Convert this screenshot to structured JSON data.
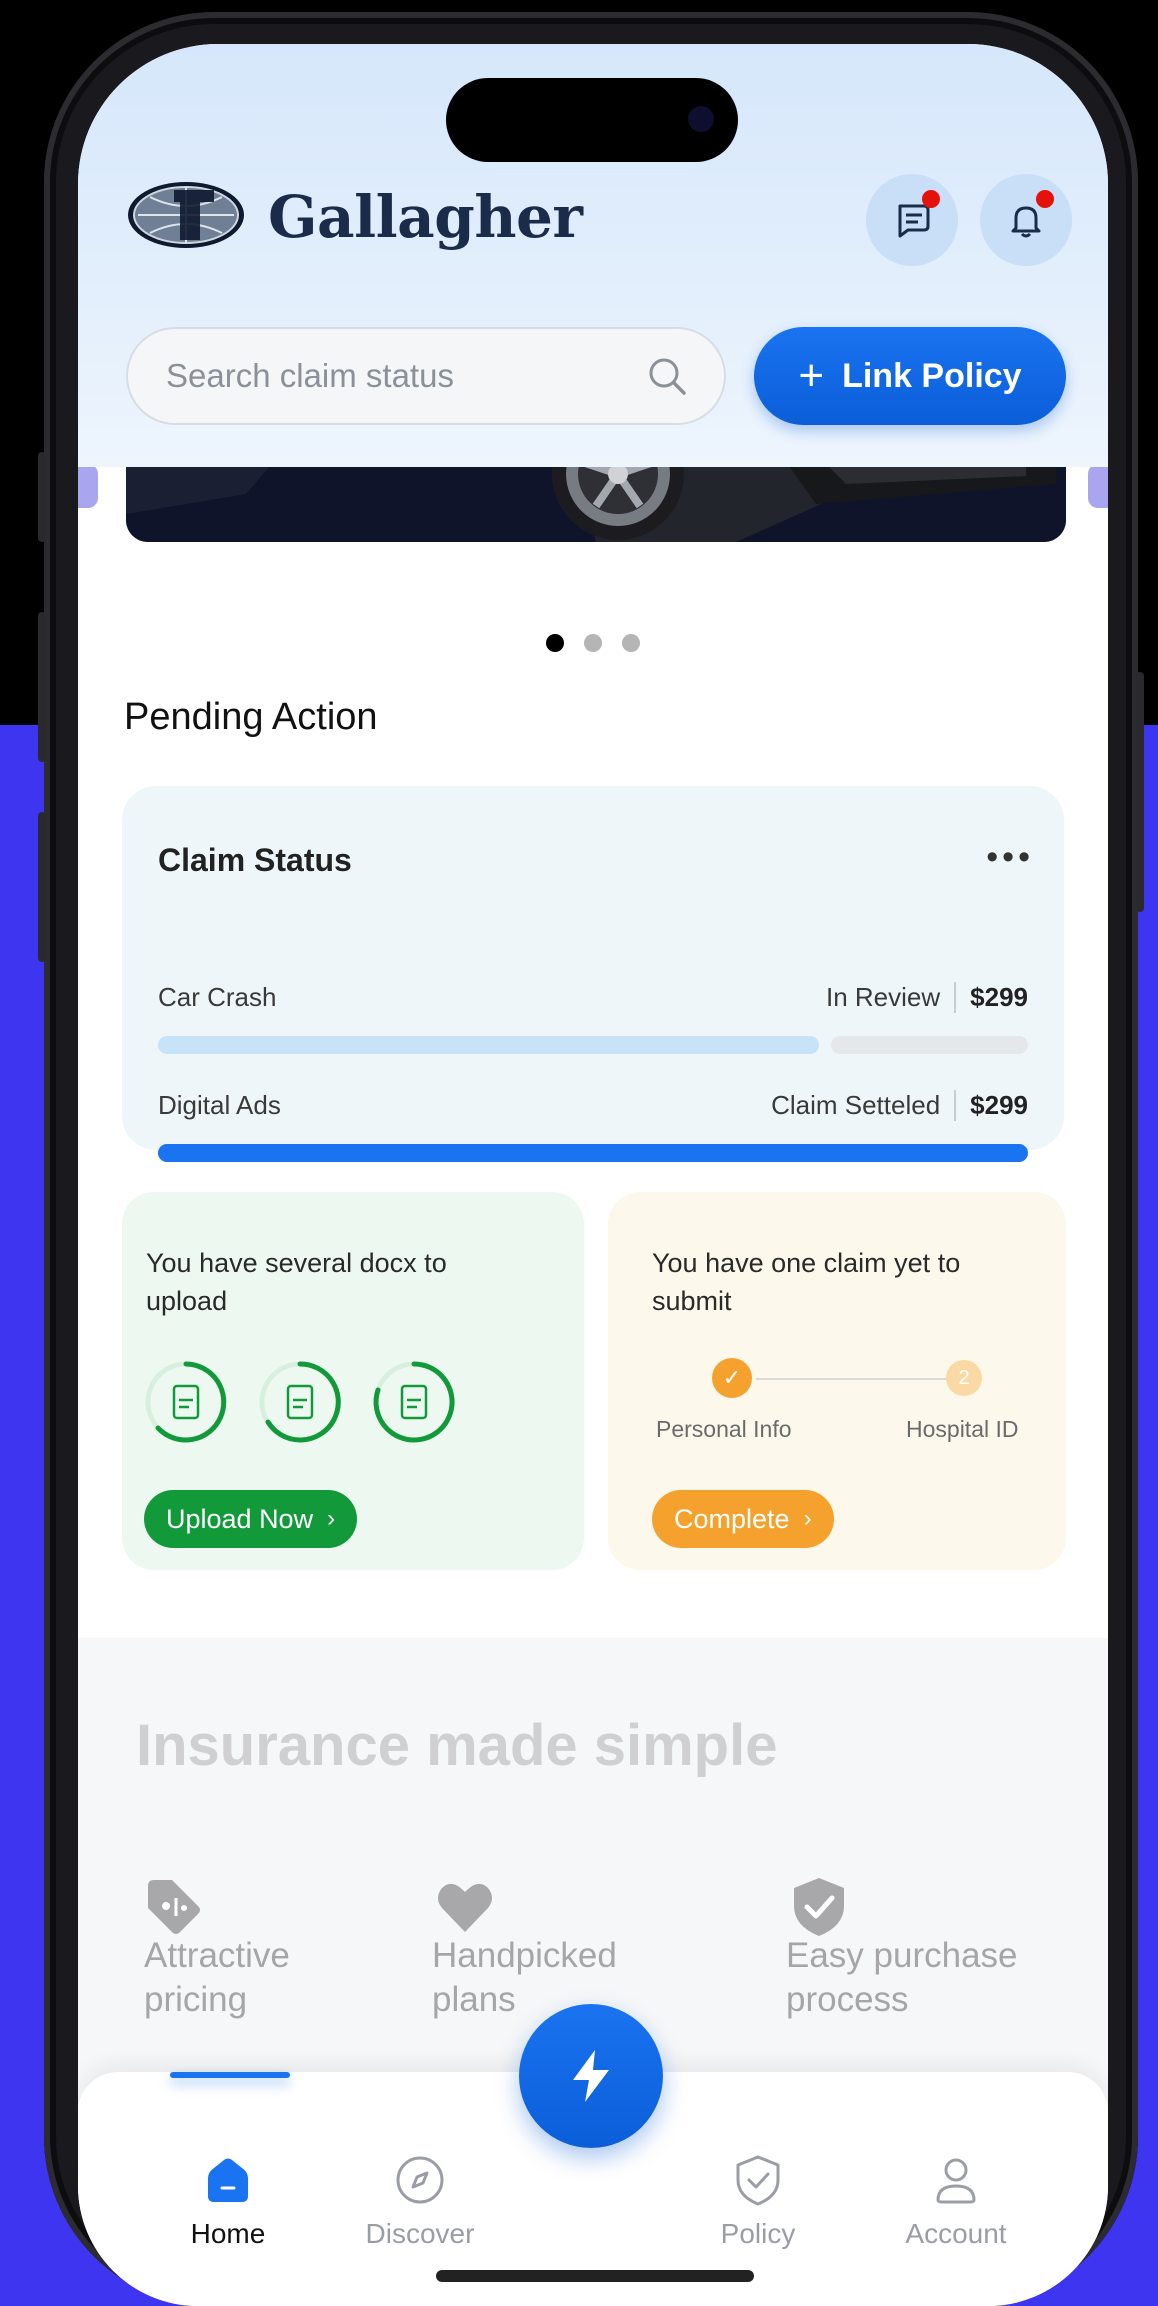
{
  "colors": {
    "primary": "#1a73f0",
    "green": "#129a3a",
    "orange": "#f5a12e",
    "backdrop": "#3d35f0"
  },
  "header": {
    "brand": "Gallagher",
    "search_placeholder": "Search claim status",
    "link_policy_label": "Link Policy",
    "icons": [
      "chat-icon",
      "bell-icon"
    ]
  },
  "banner": {
    "page_count": 3,
    "active_page": 1
  },
  "pending": {
    "title": "Pending Action",
    "claim_card": {
      "title": "Claim Status",
      "rows": [
        {
          "name": "Car Crash",
          "status": "In Review",
          "amount": "$299",
          "progress": 0.76
        },
        {
          "name": "Digital Ads",
          "status": "Claim Setteled",
          "amount": "$299",
          "progress": 1.0
        }
      ]
    },
    "upload_card": {
      "text": "You have several docx to upload",
      "button": "Upload Now"
    },
    "submit_card": {
      "text": "You have one claim yet to submit",
      "steps": [
        {
          "label": "Personal Info",
          "marker": "✓"
        },
        {
          "label": "Hospital ID",
          "marker": "2"
        }
      ],
      "button": "Complete"
    }
  },
  "features": {
    "title": "Insurance made simple",
    "items": [
      {
        "line1": "Attractive",
        "line2": "pricing",
        "icon": "price-tag-icon"
      },
      {
        "line1": "Handpicked",
        "line2": "plans",
        "icon": "heart-icon"
      },
      {
        "line1": "Easy purchase",
        "line2": "process",
        "icon": "shield-check-icon"
      }
    ]
  },
  "nav": {
    "items": [
      {
        "label": "Home",
        "active": true
      },
      {
        "label": "Discover",
        "active": false
      },
      {
        "label": "Policy",
        "active": false
      },
      {
        "label": "Account",
        "active": false
      }
    ]
  }
}
